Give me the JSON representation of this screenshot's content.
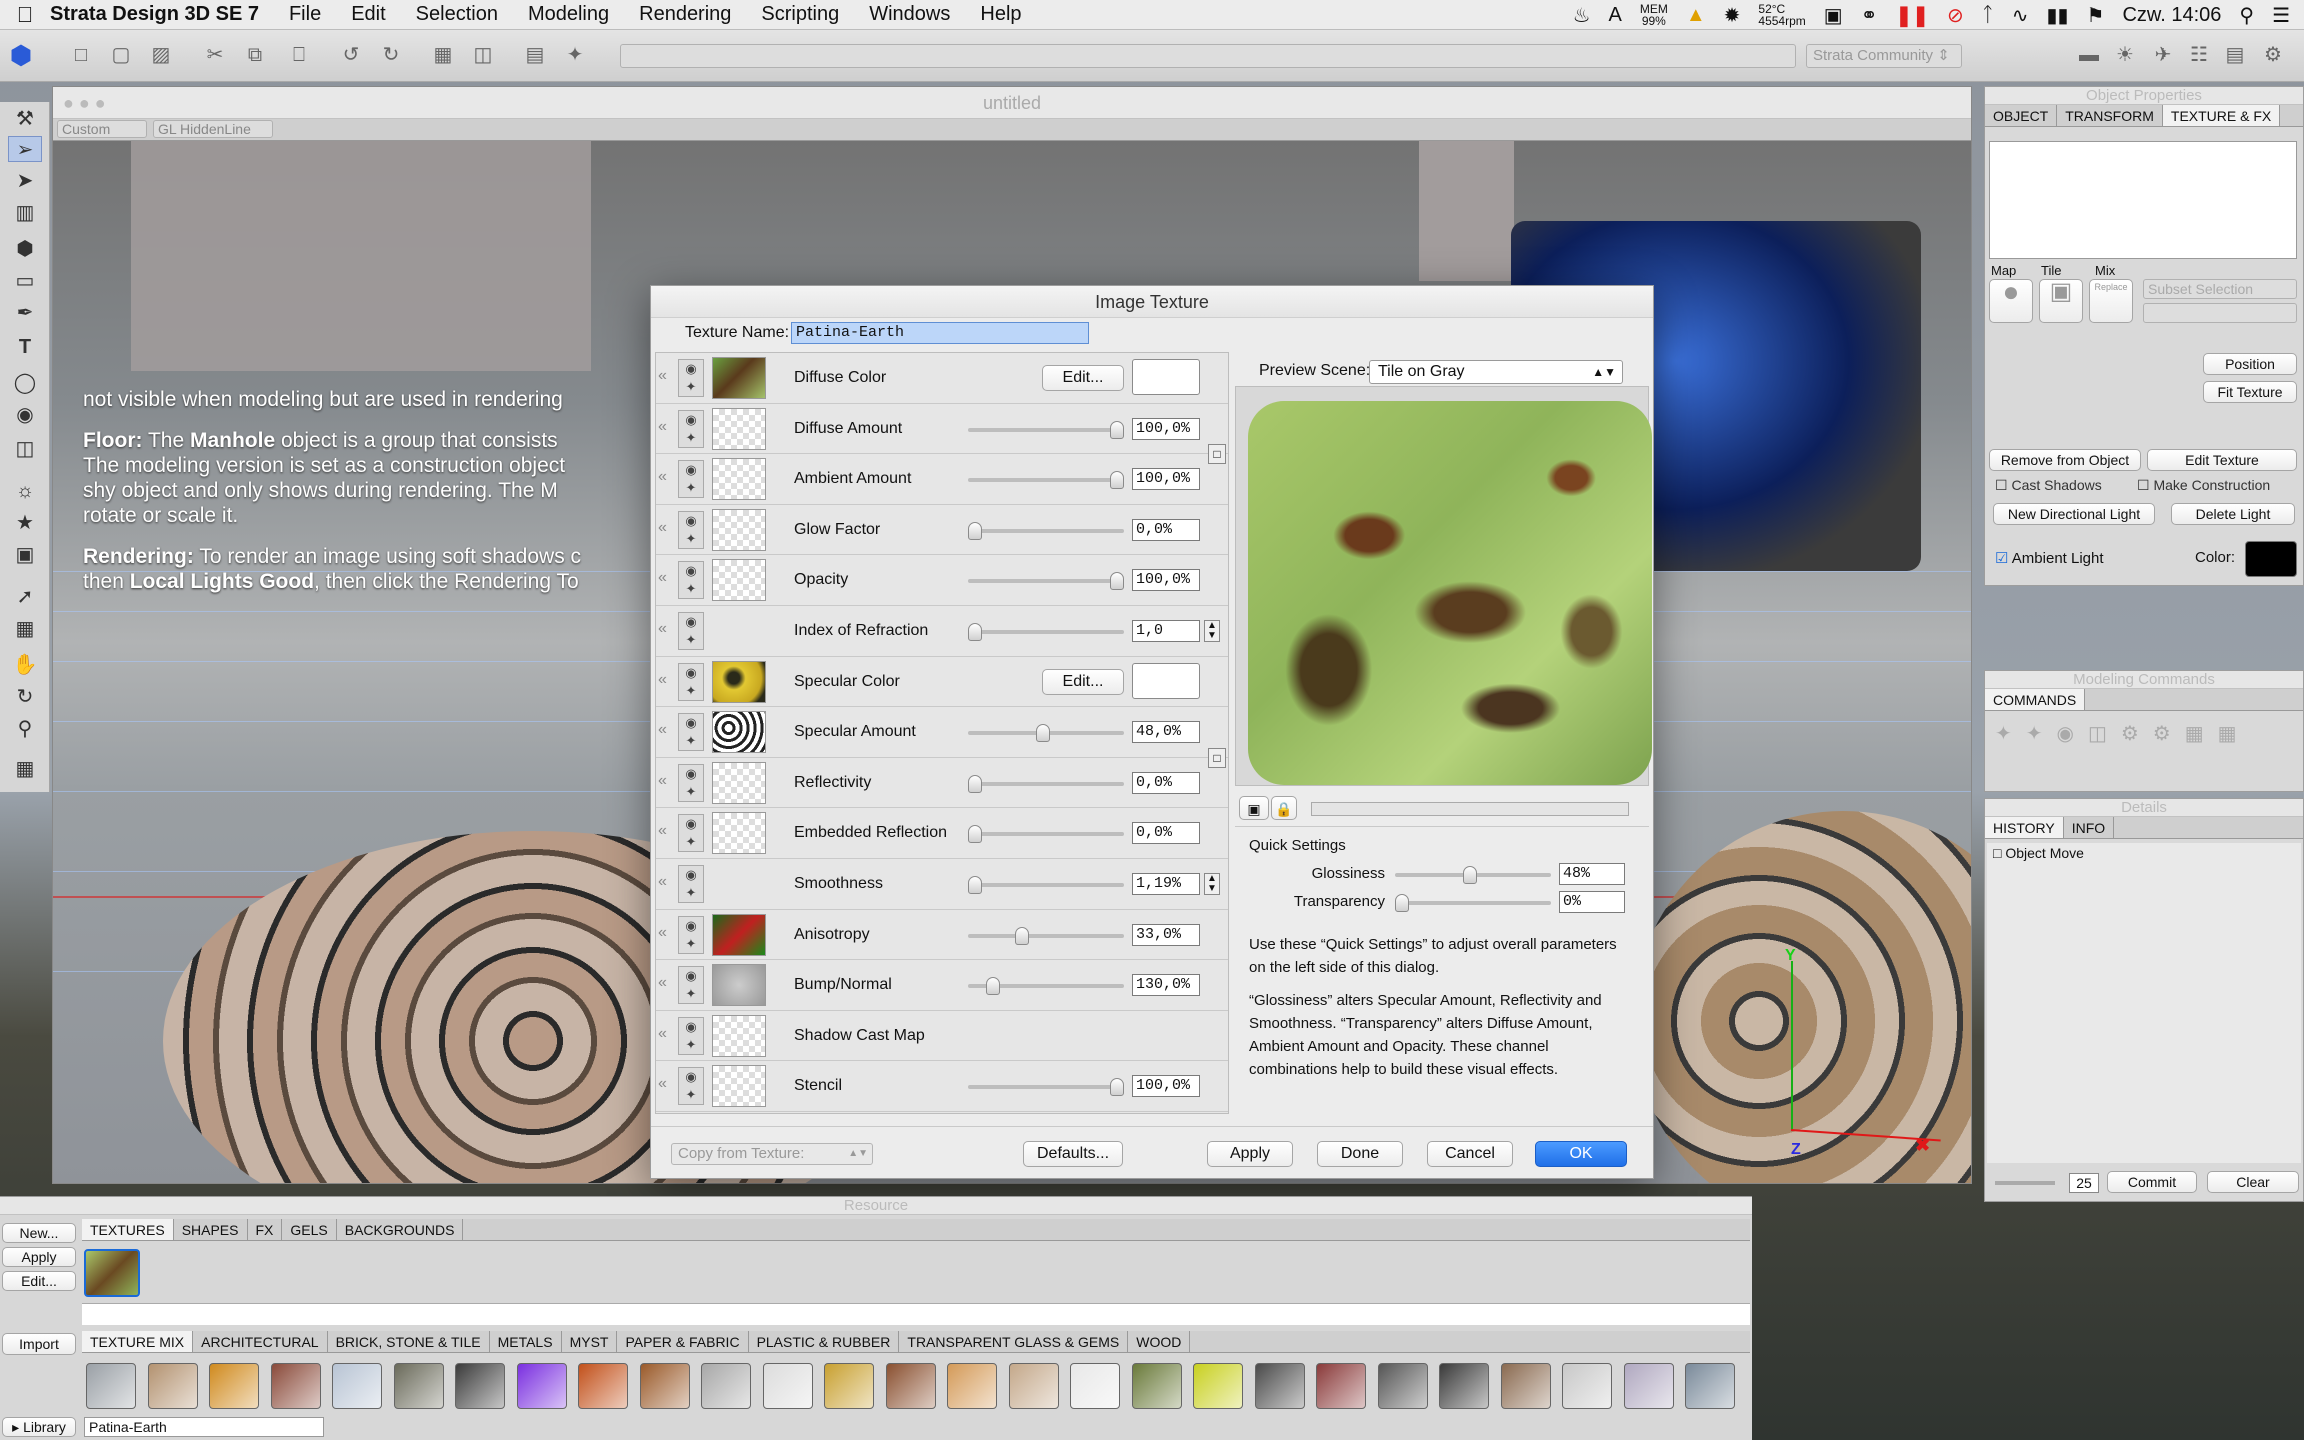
{
  "menubar": {
    "app": "Strata Design 3D SE 7",
    "menus": [
      "File",
      "Edit",
      "Selection",
      "Modeling",
      "Rendering",
      "Scripting",
      "Windows",
      "Help"
    ],
    "status": {
      "mem": "MEM",
      "mem_pct": "99%",
      "temp": "52°C",
      "rpm": "4554rpm",
      "clock": "Czw. 14:06"
    }
  },
  "toolbar": {
    "community": "Strata Community"
  },
  "window": {
    "title": "untitled",
    "view_preset": "Custom",
    "render_mode": "GL HiddenLine"
  },
  "help": {
    "p1": "not visible when modeling but are used in rendering",
    "p2_label": "Floor:",
    "p2_a": "The",
    "p2_obj": "Manhole",
    "p2_b": "object is a group that consists",
    "p2_c": "The modeling version is set as a construction object",
    "p2_d": "shy object and only shows during rendering. The M",
    "p2_e": "rotate or scale it.",
    "p3_label": "Rendering:",
    "p3_a": "To render an image using soft shadows c",
    "p3_b": "then",
    "p3_c": "Local Lights Good",
    "p3_d": ", then click the Rendering To"
  },
  "dialog": {
    "title": "Image Texture",
    "texture_name_label": "Texture Name:",
    "texture_name": "Patina-Earth",
    "channels": [
      {
        "label": "Diffuse Color",
        "type": "color",
        "button": "Edit...",
        "swatch": "texture"
      },
      {
        "label": "Diffuse Amount",
        "type": "slider",
        "value": "100,0%",
        "pos": 1.0
      },
      {
        "label": "Ambient Amount",
        "type": "slider",
        "value": "100,0%",
        "pos": 1.0
      },
      {
        "label": "Glow Factor",
        "type": "slider",
        "value": "0,0%",
        "pos": 0.0
      },
      {
        "label": "Opacity",
        "type": "slider",
        "value": "100,0%",
        "pos": 1.0
      },
      {
        "label": "Index of Refraction",
        "type": "slider",
        "value": "1,0",
        "pos": 0.0,
        "stepper": true
      },
      {
        "label": "Specular Color",
        "type": "color",
        "button": "Edit...",
        "swatch": "yellow"
      },
      {
        "label": "Specular Amount",
        "type": "slider",
        "value": "48,0%",
        "pos": 0.48
      },
      {
        "label": "Reflectivity",
        "type": "slider",
        "value": "0,0%",
        "pos": 0.0
      },
      {
        "label": "Embedded Reflection",
        "type": "slider",
        "value": "0,0%",
        "pos": 0.0
      },
      {
        "label": "Smoothness",
        "type": "slider",
        "value": "1,19%",
        "pos": 0.0,
        "stepper": true
      },
      {
        "label": "Anisotropy",
        "type": "slider",
        "value": "33,0%",
        "pos": 0.33
      },
      {
        "label": "Bump/Normal",
        "type": "slider",
        "value": "130,0%",
        "pos": 0.13
      },
      {
        "label": "Shadow Cast Map",
        "type": "none"
      },
      {
        "label": "Stencil",
        "type": "slider",
        "value": "100,0%",
        "pos": 1.0
      }
    ],
    "preview_label": "Preview Scene:",
    "preview_scene": "Tile on Gray",
    "quick": {
      "title": "Quick Settings",
      "gloss_label": "Glossiness",
      "gloss": "48%",
      "gloss_pos": 0.48,
      "trans_label": "Transparency",
      "trans": "0%",
      "trans_pos": 0.0,
      "p1": "Use these “Quick Settings” to adjust overall parameters on the left side of this dialog.",
      "p2": "“Glossiness” alters Specular Amount, Reflectivity and Smoothness. “Transparency” alters Diffuse Amount, Ambient Amount and Opacity. These channel combinations help to build these visual effects."
    },
    "copy_from": "Copy from Texture:",
    "defaults": "Defaults...",
    "apply": "Apply",
    "done": "Done",
    "cancel": "Cancel",
    "ok": "OK"
  },
  "objprops": {
    "title": "Object Properties",
    "tabs": [
      "Object",
      "Transform",
      "Texture & FX"
    ],
    "map": "Map",
    "tile": "Tile",
    "mix": "Mix",
    "replace": "Replace",
    "subset": "Subset Selection",
    "position": "Position",
    "fit": "Fit Texture",
    "remove": "Remove from Object",
    "edit_tex": "Edit Texture",
    "cast_shadows": "Cast Shadows",
    "make_construction": "Make Construction",
    "new_light": "New Directional Light",
    "delete_light": "Delete Light",
    "ambient": "Ambient Light",
    "color": "Color:"
  },
  "modcmd": {
    "title": "Modeling Commands",
    "tab": "Commands"
  },
  "details": {
    "title": "Details",
    "tabs": [
      "History",
      "Info"
    ],
    "history_item": "Object Move",
    "count": "25",
    "commit": "Commit",
    "clear": "Clear"
  },
  "resource": {
    "title": "Resource",
    "new": "New...",
    "apply": "Apply",
    "edit": "Edit...",
    "import": "Import",
    "library": "Library",
    "tabs": [
      "Textures",
      "Shapes",
      "FX",
      "Gels",
      "Backgrounds"
    ],
    "lib_tabs": [
      "Texture Mix",
      "Architectural",
      "Brick, Stone & Tile",
      "Metals",
      "Myst",
      "Paper & Fabric",
      "Plastic & Rubber",
      "Transparent Glass & Gems",
      "Wood"
    ],
    "selected": "Patina-Earth",
    "swatches": [
      "#9aa0a6",
      "#b39270",
      "#d08a1e",
      "#8a4a3a",
      "#b8c4d4",
      "#6a6a5a",
      "#3b3b3b",
      "#7a2fe0",
      "#c2501a",
      "#9a5a2a",
      "#a8a8a8",
      "#dcdcdc",
      "#c8a030",
      "#8a5030",
      "#d49a58",
      "#c4a88a",
      "#e8e8e8",
      "#6a7a3a",
      "#c8d020",
      "#4a4a4a",
      "#8a3a3a",
      "#555555",
      "#3a3a3a",
      "#8a6a50",
      "#c8c8c8",
      "#b0a8c0",
      "#7a8a9a"
    ]
  },
  "axes": {
    "y": "Y",
    "z": "Z"
  }
}
